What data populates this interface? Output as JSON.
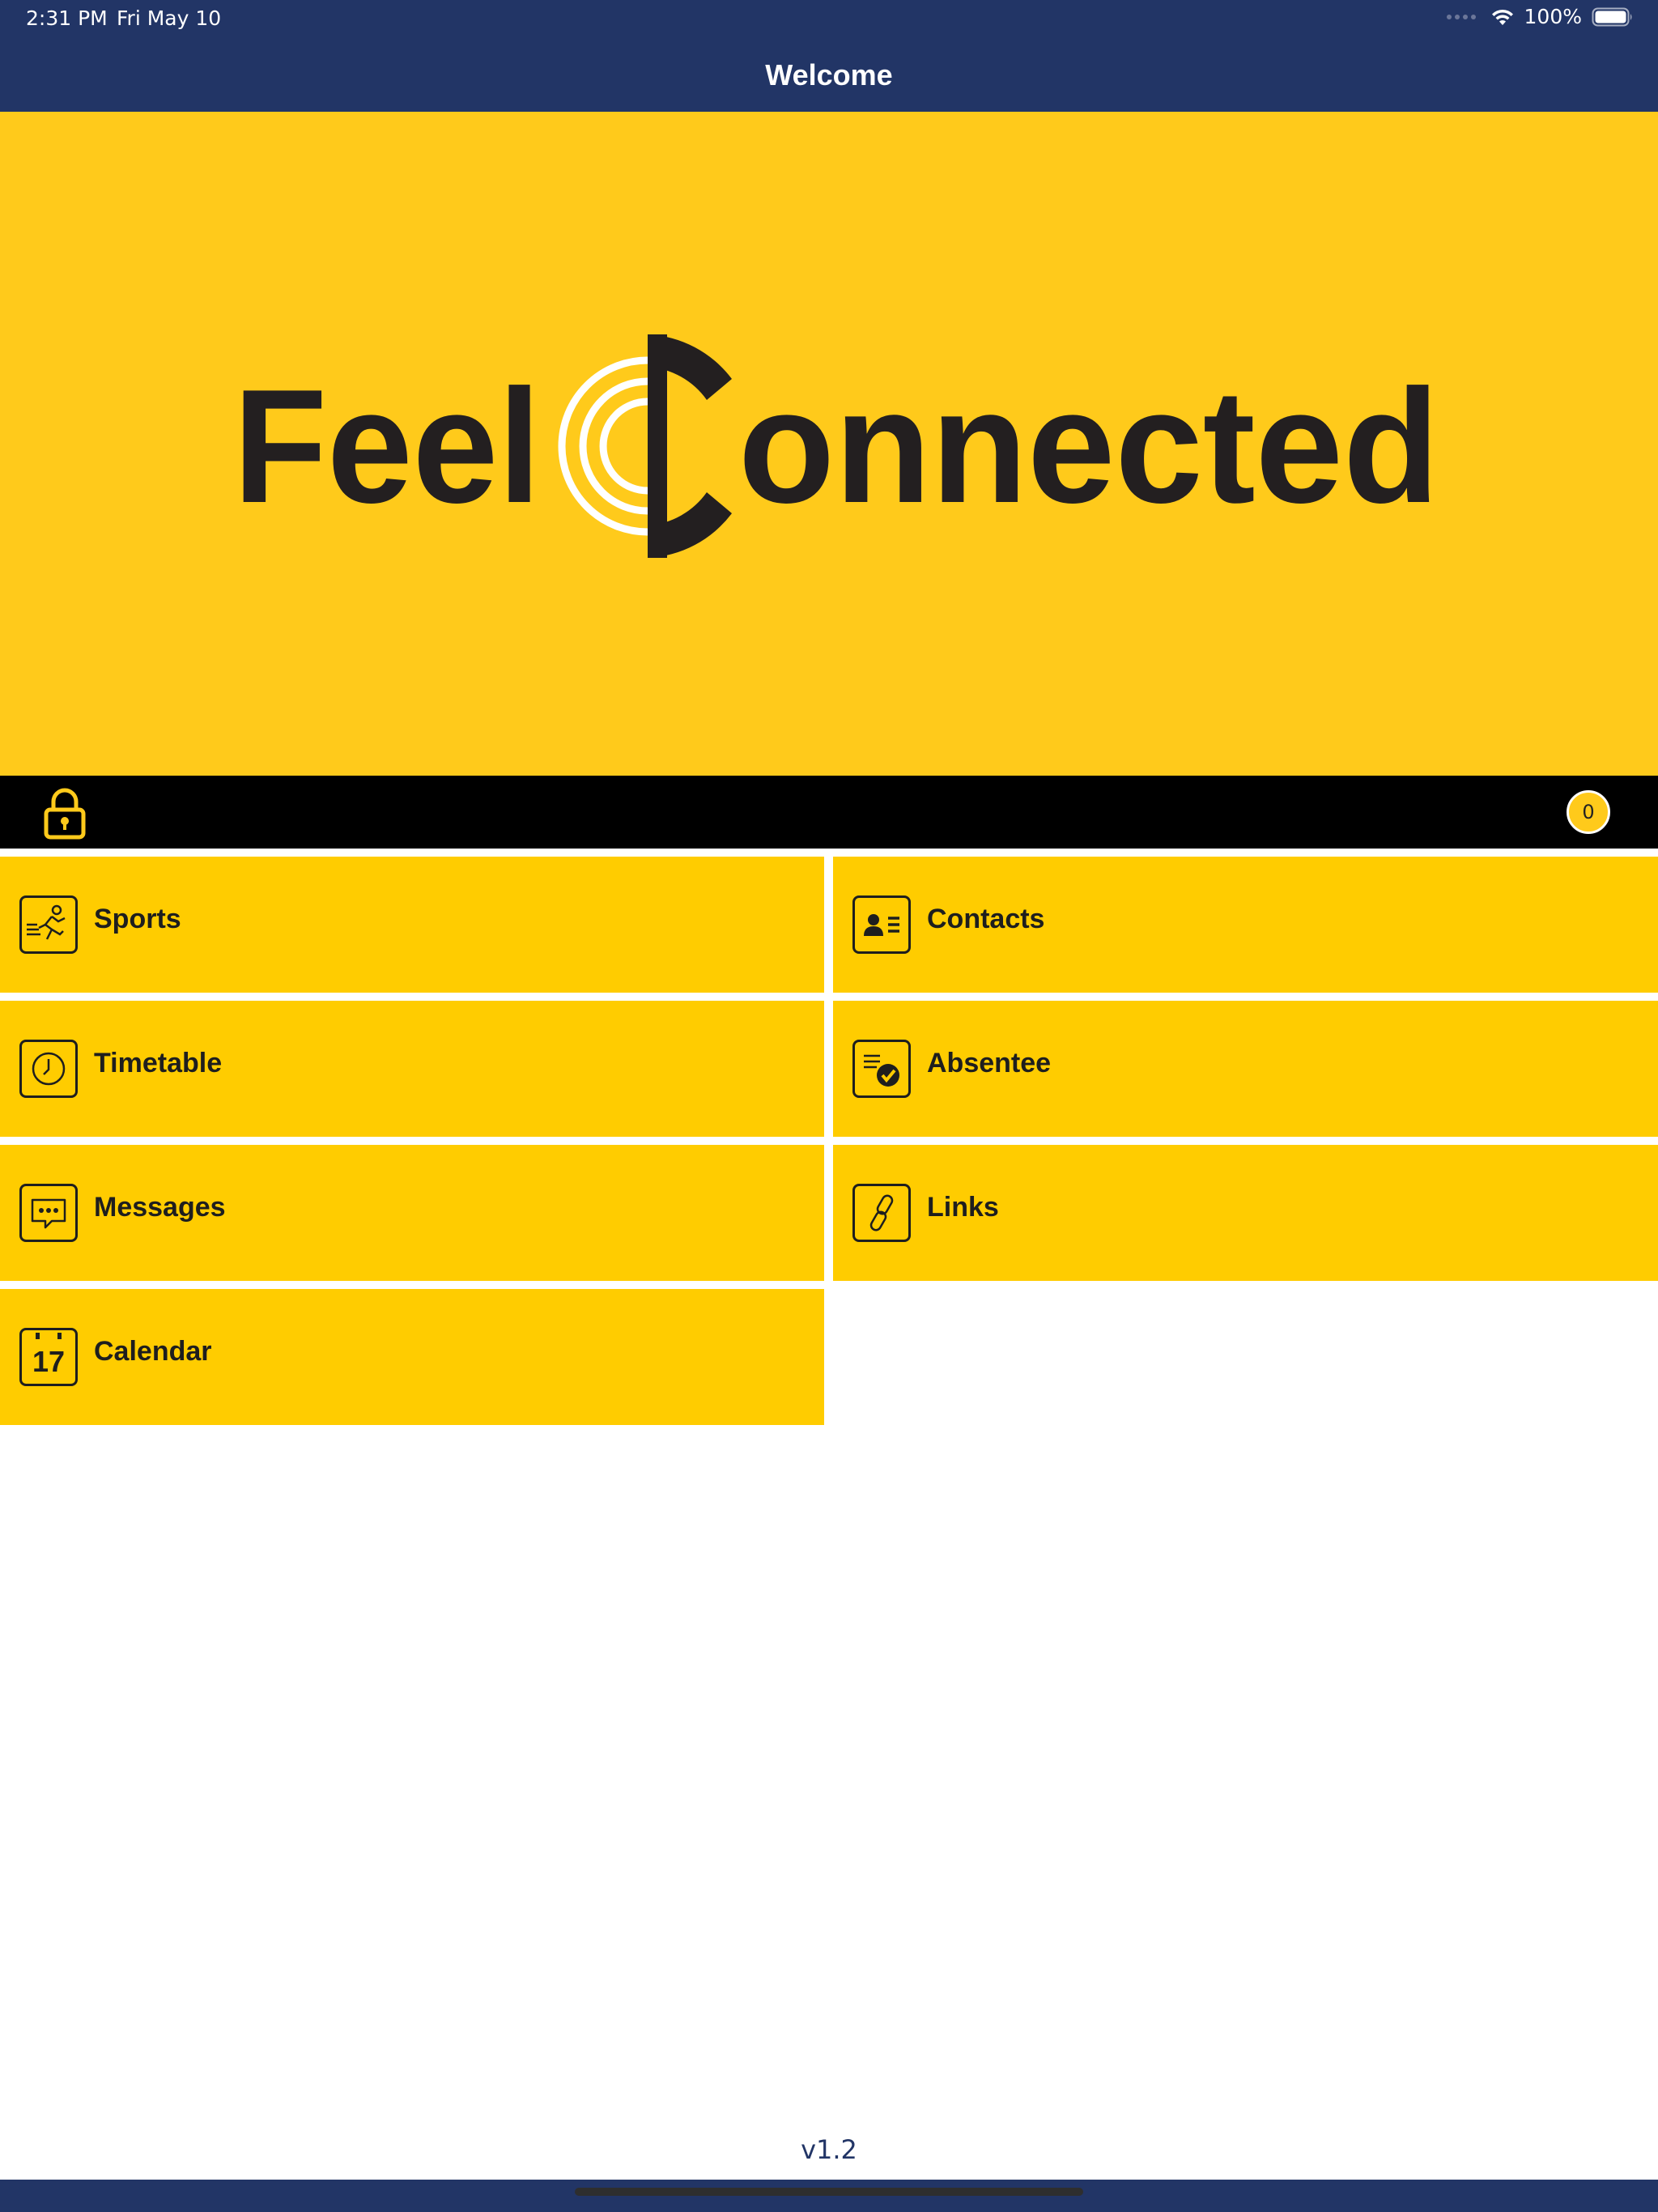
{
  "status_bar": {
    "time": "2:31 PM",
    "date": "Fri May 10",
    "battery": "100%"
  },
  "nav": {
    "title": "Welcome"
  },
  "banner": {
    "logo_text": "Feel Connected",
    "logo_part1": "Feel",
    "logo_part2": "onnected",
    "background": "#ffca1b",
    "text_color": "#231f20"
  },
  "info_bar": {
    "notification_count": "0"
  },
  "menu": {
    "items": [
      {
        "label": "Sports",
        "icon": "runner-icon"
      },
      {
        "label": "Contacts",
        "icon": "contact-card-icon"
      },
      {
        "label": "Timetable",
        "icon": "clock-icon"
      },
      {
        "label": "Absentee",
        "icon": "checklist-icon"
      },
      {
        "label": "Messages",
        "icon": "chat-bubble-icon"
      },
      {
        "label": "Links",
        "icon": "link-icon"
      },
      {
        "label": "Calendar",
        "icon": "calendar-icon"
      }
    ]
  },
  "footer": {
    "version": "v1.2"
  },
  "colors": {
    "navy": "#223566",
    "yellow_tile": "#ffcc00",
    "black_bar": "#000000"
  }
}
